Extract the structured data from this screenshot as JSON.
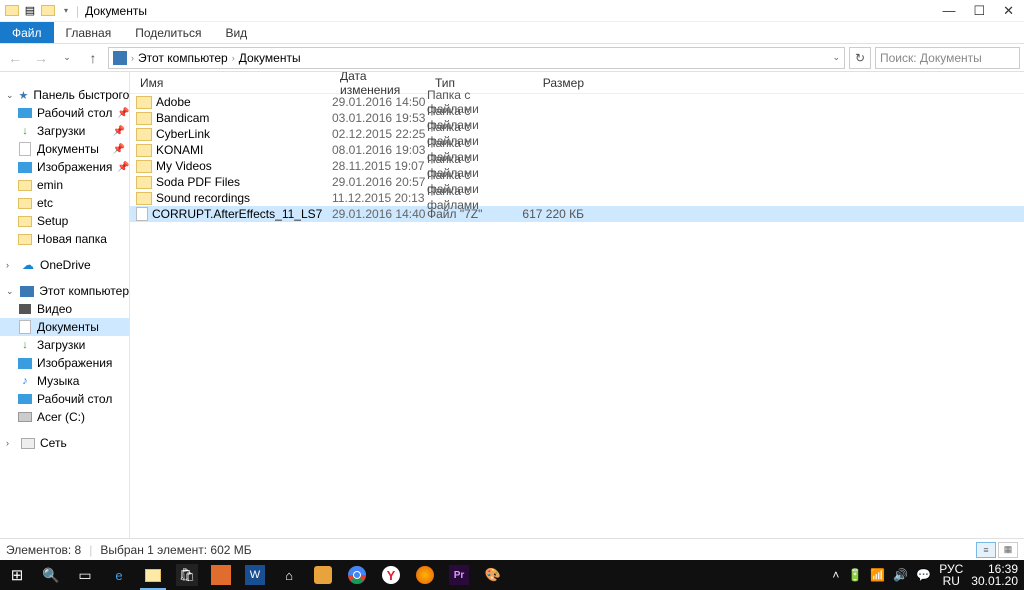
{
  "title": "Документы",
  "ribbon": {
    "file": "Файл",
    "home": "Главная",
    "share": "Поделиться",
    "view": "Вид"
  },
  "addrbar": {
    "crumb1": "Этот компьютер",
    "crumb2": "Документы",
    "search_placeholder": "Поиск: Документы"
  },
  "columns": {
    "name": "Имя",
    "date": "Дата изменения",
    "type": "Тип",
    "size": "Размер"
  },
  "nav": {
    "quick": "Панель быстрого дс",
    "desktop": "Рабочий стол",
    "downloads": "Загрузки",
    "documents": "Документы",
    "pictures": "Изображения",
    "emin": "emin",
    "etc": "etc",
    "setup": "Setup",
    "newfolder": "Новая папка",
    "onedrive": "OneDrive",
    "thispc": "Этот компьютер",
    "video": "Видео",
    "documents2": "Документы",
    "downloads2": "Загрузки",
    "pictures2": "Изображения",
    "music": "Музыка",
    "desktop2": "Рабочий стол",
    "drive": "Acer (C:)",
    "network": "Сеть"
  },
  "files": [
    {
      "name": "Adobe",
      "date": "29.01.2016 14:50",
      "type": "Папка с файлами",
      "size": "",
      "kind": "folder"
    },
    {
      "name": "Bandicam",
      "date": "03.01.2016 19:53",
      "type": "Папка с файлами",
      "size": "",
      "kind": "folder"
    },
    {
      "name": "CyberLink",
      "date": "02.12.2015 22:25",
      "type": "Папка с файлами",
      "size": "",
      "kind": "folder"
    },
    {
      "name": "KONAMI",
      "date": "08.01.2016 19:03",
      "type": "Папка с файлами",
      "size": "",
      "kind": "folder"
    },
    {
      "name": "My Videos",
      "date": "28.11.2015 19:07",
      "type": "Папка с файлами",
      "size": "",
      "kind": "folder"
    },
    {
      "name": "Soda PDF Files",
      "date": "29.01.2016 20:57",
      "type": "Папка с файлами",
      "size": "",
      "kind": "folder"
    },
    {
      "name": "Sound recordings",
      "date": "11.12.2015 20:13",
      "type": "Папка с файлами",
      "size": "",
      "kind": "folder"
    },
    {
      "name": "CORRUPT.AfterEffects_11_LS7",
      "date": "29.01.2016 14:40",
      "type": "Файл \"7Z\"",
      "size": "617 220 КБ",
      "kind": "file",
      "selected": true
    }
  ],
  "status": {
    "count": "Элементов: 8",
    "selection": "Выбран 1 элемент: 602 МБ"
  },
  "tray": {
    "lang1": "РУС",
    "lang2": "RU",
    "time": "16:39",
    "date": "30.01.20"
  }
}
